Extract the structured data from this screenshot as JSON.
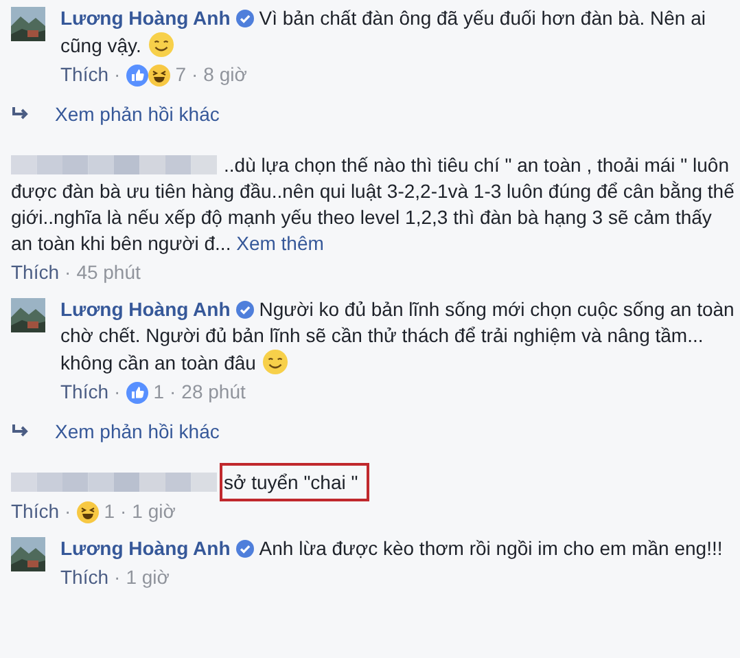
{
  "separator": "·",
  "items": [
    {
      "kind": "reply",
      "author": "Lương Hoàng Anh",
      "verified": true,
      "text": "Vì bản chất đàn ông đã yếu đuối hơn đàn bà. Nên ai cũng vậy.",
      "emoji": true,
      "like_label": "Thích",
      "reactions": [
        {
          "kind": "like"
        },
        {
          "kind": "haha"
        }
      ],
      "count": "7",
      "time": "8 giờ"
    },
    {
      "kind": "more_replies",
      "label": "Xem phản hồi khác"
    },
    {
      "kind": "comment",
      "text": "..dù lựa chọn thế nào thì tiêu chí \" an toàn , thoải mái \" luôn được đàn bà ưu tiên hàng đầu..nên qui luật 3-2,2-1và 1-3 luôn đúng để cân bằng thế giới..nghĩa là nếu xếp độ mạnh yếu theo level 1,2,3 thì đàn bà hạng 3 sẽ cảm thấy an toàn khi bên người đ...",
      "see_more": "Xem thêm",
      "highlighted": false,
      "like_label": "Thích",
      "time": "45 phút"
    },
    {
      "kind": "reply",
      "author": "Lương Hoàng Anh",
      "verified": true,
      "text": "Người ko đủ bản lĩnh sống mới chọn cuộc sống an toàn chờ chết. Người đủ bản lĩnh sẽ cần thử thách để trải nghiệm và nâng tầm... không cần an toàn đâu",
      "emoji": true,
      "like_label": "Thích",
      "reactions": [
        {
          "kind": "like"
        }
      ],
      "count": "1",
      "time": "28 phút"
    },
    {
      "kind": "more_replies",
      "label": "Xem phản hồi khác"
    },
    {
      "kind": "comment",
      "text": "sở tuyển \"chai \"",
      "highlighted": true,
      "like_label": "Thích",
      "reactions": [
        {
          "kind": "haha"
        }
      ],
      "count": "1",
      "time": "1 giờ"
    },
    {
      "kind": "reply",
      "author": "Lương Hoàng Anh",
      "verified": true,
      "text": "Anh lừa được kèo thơm rồi ngồi im cho em mần eng!!!",
      "emoji": false,
      "like_label": "Thích",
      "time": "1 giờ"
    }
  ]
}
